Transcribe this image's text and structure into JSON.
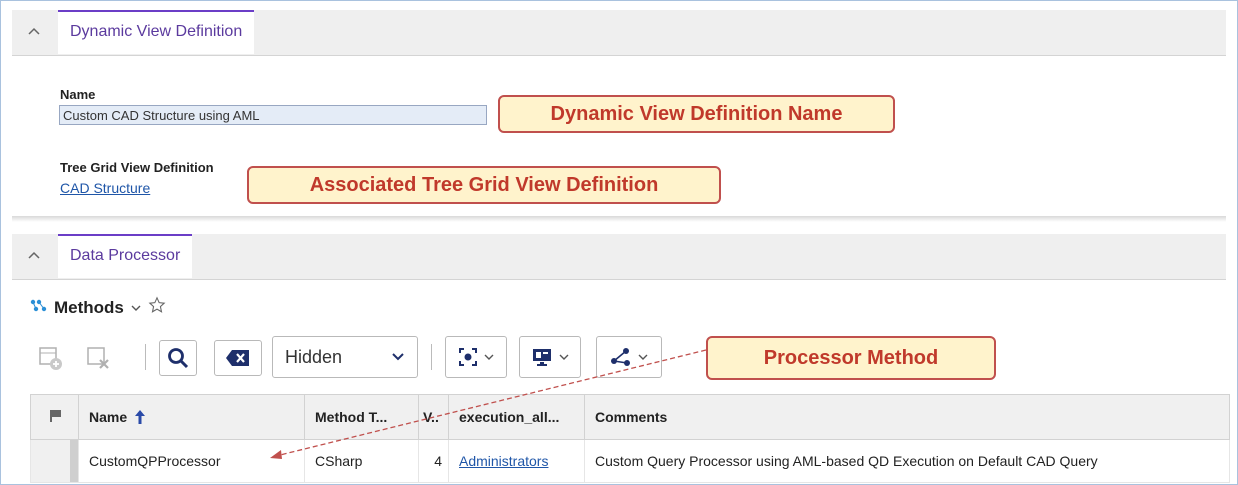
{
  "section1": {
    "tab_label": "Dynamic View Definition",
    "name_label": "Name",
    "name_value": "Custom CAD Structure using AML",
    "tree_label": "Tree Grid View Definition",
    "tree_link": "CAD Structure"
  },
  "section2": {
    "tab_label": "Data Processor",
    "methods_title": "Methods"
  },
  "toolbar": {
    "view_select": "Hidden"
  },
  "grid": {
    "headers": [
      "Name",
      "Method T...",
      "V..",
      "execution_all...",
      "Comments"
    ],
    "rows": [
      [
        "CustomQPProcessor",
        "CSharp",
        "4",
        "Administrators",
        "Custom Query Processor using AML-based QD Execution on Default CAD Query"
      ]
    ]
  },
  "callouts": {
    "name": "Dynamic View Definition Name",
    "tree": "Associated Tree Grid View Definition",
    "processor": "Processor Method"
  },
  "colors": {
    "accent": "#6b3ec7",
    "callout_border": "#c0504d",
    "callout_bg": "#fff3cc",
    "callout_text": "#c0392b",
    "link": "#1f56a8"
  }
}
